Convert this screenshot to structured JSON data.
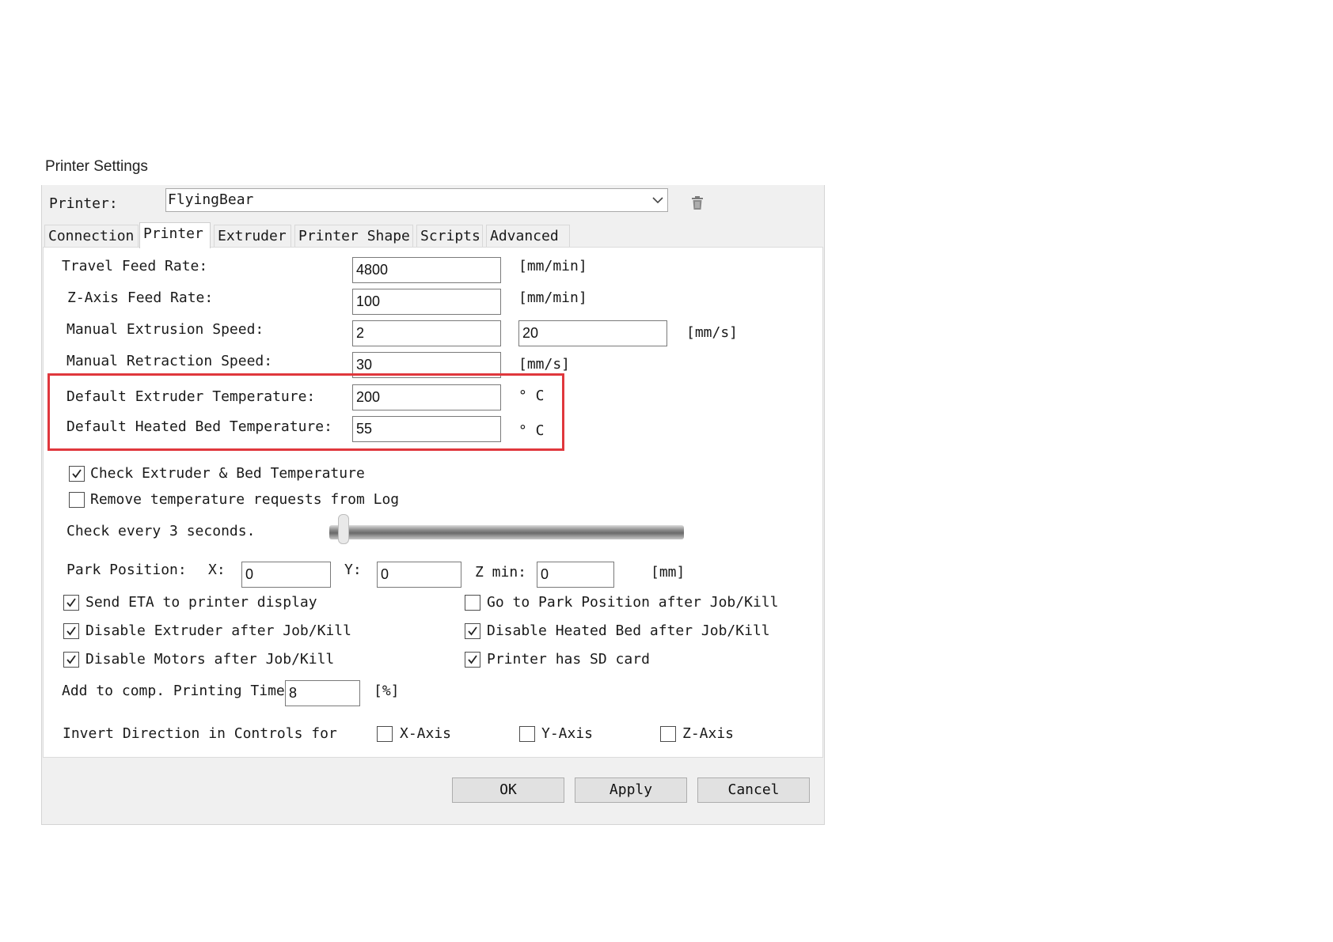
{
  "window": {
    "title": "Printer Settings"
  },
  "printer": {
    "label": "Printer:",
    "selected": "FlyingBear"
  },
  "tabs": [
    "Connection",
    "Printer",
    "Extruder",
    "Printer Shape",
    "Scripts",
    "Advanced"
  ],
  "active_tab": "Printer",
  "settings": {
    "travel_feed_rate": {
      "label": "Travel Feed Rate:",
      "value": "4800",
      "unit": "[mm/min]"
    },
    "z_axis_feed_rate": {
      "label": "Z-Axis Feed Rate:",
      "value": "100",
      "unit": "[mm/min]"
    },
    "manual_extrusion_speed": {
      "label": "Manual Extrusion Speed:",
      "value": "2",
      "value2": "20",
      "unit": "[mm/s]"
    },
    "manual_retraction_speed": {
      "label": "Manual Retraction Speed:",
      "value": "30",
      "unit": "[mm/s]"
    },
    "default_extruder_temp": {
      "label": "Default Extruder Temperature:",
      "value": "200",
      "unit": "° C"
    },
    "default_bed_temp": {
      "label": "Default Heated Bed Temperature:",
      "value": "55",
      "unit": "° C"
    }
  },
  "check_temp": {
    "label": "Check Extruder & Bed Temperature",
    "checked": true
  },
  "remove_temp_requests": {
    "label": "Remove temperature requests from Log",
    "checked": false
  },
  "check_every": {
    "label": "Check every 3 seconds.",
    "slider_value": 3
  },
  "park": {
    "label": "Park Position:",
    "x_label": "X:",
    "x": "0",
    "y_label": "Y:",
    "y": "0",
    "zmin_label": "Z min:",
    "zmin": "0",
    "unit": "[mm]"
  },
  "options": {
    "send_eta": {
      "label": "Send ETA to printer display",
      "checked": true
    },
    "go_to_park": {
      "label": "Go to Park Position after Job/Kill",
      "checked": false
    },
    "disable_extruder": {
      "label": "Disable Extruder after Job/Kill",
      "checked": true
    },
    "disable_bed": {
      "label": "Disable Heated Bed after Job/Kill",
      "checked": true
    },
    "disable_motors": {
      "label": "Disable Motors after Job/Kill",
      "checked": true
    },
    "sd_card": {
      "label": "Printer has SD card",
      "checked": true
    }
  },
  "add_comp": {
    "label": "Add to comp. Printing Time",
    "value": "8",
    "unit": "[%]"
  },
  "invert": {
    "label": "Invert Direction in Controls for",
    "x": {
      "label": "X-Axis",
      "checked": false
    },
    "y": {
      "label": "Y-Axis",
      "checked": false
    },
    "z": {
      "label": "Z-Axis",
      "checked": false
    }
  },
  "buttons": {
    "ok": "OK",
    "apply": "Apply",
    "cancel": "Cancel"
  },
  "colors": {
    "highlight": "#e0373d"
  }
}
